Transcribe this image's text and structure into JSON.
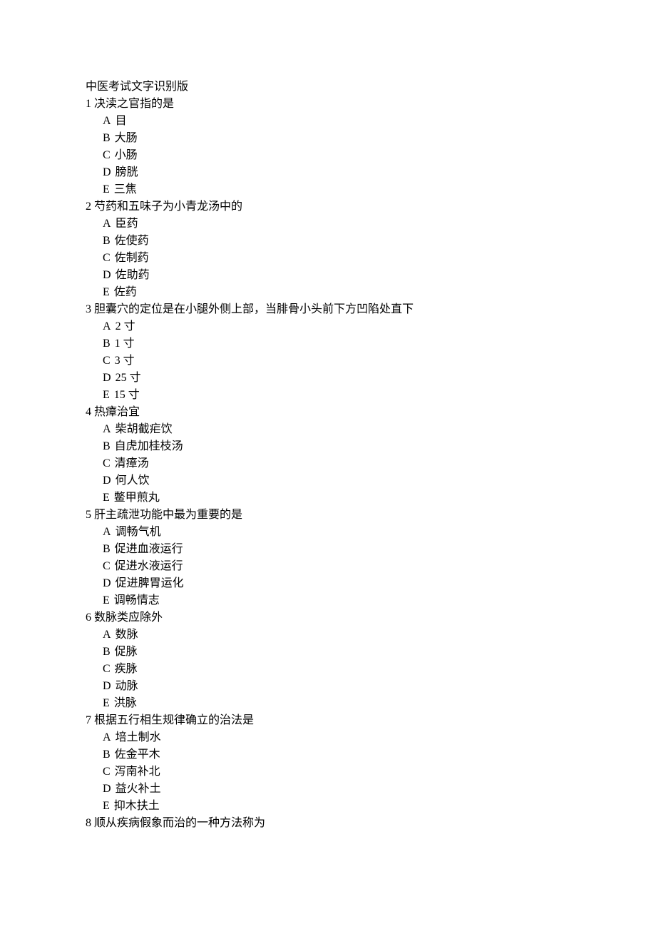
{
  "title": "中医考试文字识别版",
  "questions": [
    {
      "num_text": "1 决渎之官指的是",
      "options": [
        {
          "label": "A",
          "text": "目"
        },
        {
          "label": "B",
          "text": "大肠"
        },
        {
          "label": "C",
          "text": "小肠"
        },
        {
          "label": "D",
          "text": "膀胱"
        },
        {
          "label": "E",
          "text": "三焦"
        }
      ]
    },
    {
      "num_text": "2 芍药和五味子为小青龙汤中的",
      "options": [
        {
          "label": "A",
          "text": "臣药"
        },
        {
          "label": "B",
          "text": "佐使药"
        },
        {
          "label": "C",
          "text": "佐制药"
        },
        {
          "label": "D",
          "text": "佐助药"
        },
        {
          "label": "E",
          "text": "佐药"
        }
      ]
    },
    {
      "num_text": "3 胆囊穴的定位是在小腿外侧上部，当腓骨小头前下方凹陷处直下",
      "options": [
        {
          "label": "A",
          "text": "2 寸"
        },
        {
          "label": "B",
          "text": "1 寸"
        },
        {
          "label": "C",
          "text": "3 寸"
        },
        {
          "label": "D",
          "text": "25 寸"
        },
        {
          "label": "E",
          "text": "15 寸"
        }
      ]
    },
    {
      "num_text": "4 热瘴治宜",
      "options": [
        {
          "label": "A",
          "text": "柴胡截疟饮"
        },
        {
          "label": "B",
          "text": "自虎加桂枝汤"
        },
        {
          "label": "C",
          "text": "清瘴汤"
        },
        {
          "label": "D",
          "text": "何人饮"
        },
        {
          "label": "E",
          "text": "鳖甲煎丸"
        }
      ]
    },
    {
      "num_text": "5 肝主疏泄功能中最为重要的是",
      "options": [
        {
          "label": "A",
          "text": "调畅气机"
        },
        {
          "label": "B",
          "text": "促进血液运行"
        },
        {
          "label": "C",
          "text": "促进水液运行"
        },
        {
          "label": "D",
          "text": "促进脾胃运化"
        },
        {
          "label": "E",
          "text": "调畅情志"
        }
      ]
    },
    {
      "num_text": "6 数脉类应除外",
      "options": [
        {
          "label": "A",
          "text": "数脉"
        },
        {
          "label": "B",
          "text": "促脉"
        },
        {
          "label": "C",
          "text": "疾脉"
        },
        {
          "label": "D",
          "text": "动脉"
        },
        {
          "label": "E",
          "text": "洪脉"
        }
      ]
    },
    {
      "num_text": "7 根据五行相生规律确立的治法是",
      "options": [
        {
          "label": "A",
          "text": "培土制水"
        },
        {
          "label": "B",
          "text": "佐金平木"
        },
        {
          "label": "C",
          "text": "泻南补北"
        },
        {
          "label": "D",
          "text": "益火补土"
        },
        {
          "label": "E",
          "text": "抑木扶土"
        }
      ]
    },
    {
      "num_text": "8 顺从疾病假象而治的一种方法称为",
      "options": []
    }
  ]
}
